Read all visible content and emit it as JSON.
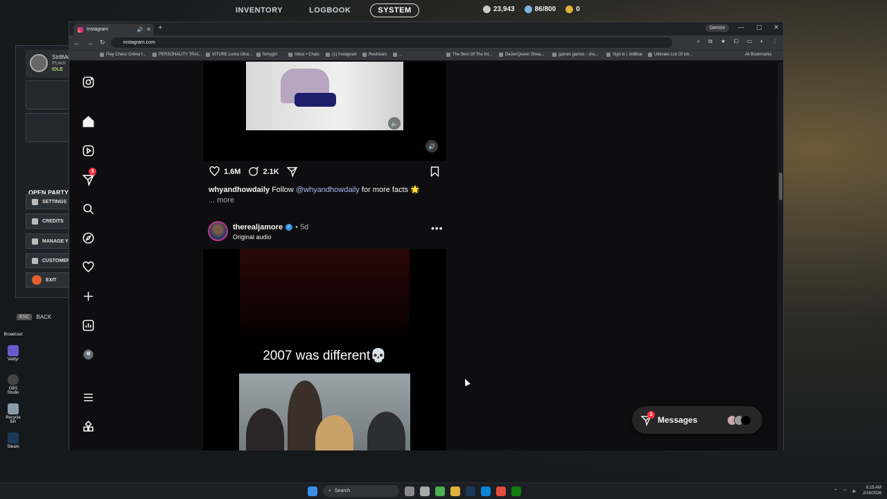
{
  "game": {
    "nav": [
      "INVENTORY",
      "LOGBOOK",
      "SYSTEM"
    ],
    "active_nav": "SYSTEM",
    "currency": [
      {
        "value": "23,943",
        "color": "#c9c9c9"
      },
      {
        "value": "86/800",
        "color": "#7fb3e0"
      },
      {
        "value": "0",
        "color": "#e0b23a"
      }
    ],
    "profile": {
      "name": "Str8Me",
      "sub": "PLwor",
      "status": "IDLE"
    },
    "open_party": "OPEN PARTY",
    "menu": [
      "SETTINGS",
      "CREDITS",
      "MANAGE Y",
      "CUSTOMER",
      "EXIT"
    ],
    "back": {
      "key": "ESC",
      "label": "BACK"
    },
    "desktop_icons": [
      "Broadcast",
      "Veilfyr",
      "OBS Studio",
      "Recycle Bin",
      "Steam"
    ]
  },
  "browser": {
    "tab_title": "Instagram",
    "gemini": "Gemini",
    "url": "instagram.com",
    "bookmarks": [
      "Play Chess Online f...",
      "PERSONALITY TRAI...",
      "VITURE Luma Ultra...",
      "femygirl",
      "Inbox • Chats",
      "(1) Instagram",
      "Restream",
      "...",
      "The Best Of The Int...",
      "DeJenQueen Strea...",
      "games games - sho...",
      "Sign in | JetBlue",
      "Ultimate List Of Ick..."
    ],
    "all_bookmarks": "All Bookmarks"
  },
  "sidebar": {
    "notifications_badge": "3"
  },
  "post1": {
    "likes": "1.6M",
    "comments": "2.1K",
    "caption_user": "whyandhowdaily",
    "caption_text": "Follow",
    "caption_mention": "@whyandhowdaily",
    "caption_rest": "for more facts 🌟",
    "more": "... more"
  },
  "post2": {
    "username": "therealjamore",
    "age": "• 5d",
    "audio": "Original audio",
    "video_text": "2007 was different💀"
  },
  "messages": {
    "label": "Messages",
    "badge": "3"
  },
  "taskbar": {
    "search": "Search",
    "time": "6:15 AM",
    "date": "2/16/2026"
  }
}
